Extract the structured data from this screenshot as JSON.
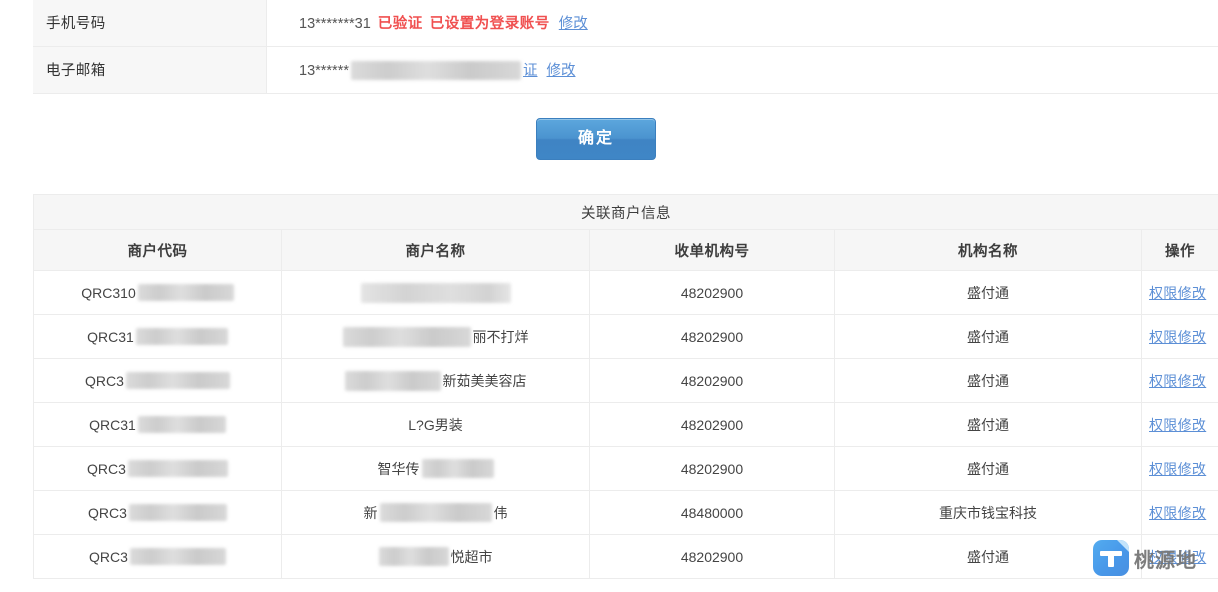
{
  "account_info": {
    "rows": [
      {
        "label": "手机号码",
        "value_prefix": "13*******31",
        "status_verified": "已验证",
        "status_login": "已设置为登录账号",
        "edit_link": "修改",
        "redacted": false
      },
      {
        "label": "电子邮箱",
        "value_prefix": "13******",
        "verify_link": "证",
        "edit_link": "修改",
        "redacted": true
      }
    ]
  },
  "confirm_button": {
    "label": "确定"
  },
  "merchant_table": {
    "title": "关联商户信息",
    "columns": [
      "商户代码",
      "商户名称",
      "收单机构号",
      "机构名称",
      "操作"
    ],
    "action_label": "权限修改",
    "rows": [
      {
        "code": "QRC310",
        "code_redacted": true,
        "name": "",
        "name_redacted": true,
        "acquirer": "48202900",
        "org": "盛付通",
        "action": "权限修改"
      },
      {
        "code": "QRC31",
        "code_redacted": true,
        "name": "丽不打烊",
        "name_redacted": true,
        "acquirer": "48202900",
        "org": "盛付通",
        "action": "权限修改"
      },
      {
        "code": "QRC3",
        "code_redacted": true,
        "name": "新茹美美容店",
        "name_redacted": true,
        "acquirer": "48202900",
        "org": "盛付通",
        "action": "权限修改"
      },
      {
        "code": "QRC31",
        "code_redacted": true,
        "name": "L?G男装",
        "name_redacted": false,
        "acquirer": "48202900",
        "org": "盛付通",
        "action": "权限修改"
      },
      {
        "code": "QRC3",
        "code_redacted": true,
        "name": "智华传",
        "name_redacted": true,
        "acquirer": "48202900",
        "org": "盛付通",
        "action": "权限修改"
      },
      {
        "code": "QRC3",
        "code_redacted": true,
        "name": "新",
        "name_suffix": "伟",
        "name_redacted": true,
        "acquirer": "48480000",
        "org": "重庆市钱宝科技",
        "action": "权限修改"
      },
      {
        "code": "QRC3",
        "code_redacted": true,
        "name": "悦超市",
        "name_redacted": true,
        "acquirer": "48202900",
        "org": "盛付通",
        "action": "权限修改"
      }
    ]
  },
  "watermark": {
    "text": "桃源地",
    "logo_letter": "T"
  },
  "colors": {
    "link": "#5c8fd6",
    "status_red": "#f05050",
    "button": "#4b93cf",
    "header_bg": "#f6f6f6",
    "border": "#ececec"
  }
}
